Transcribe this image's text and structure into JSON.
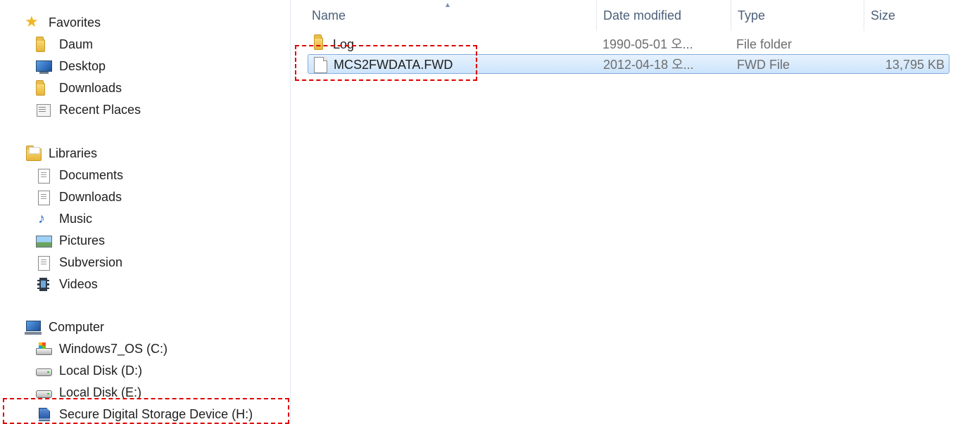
{
  "navigation": {
    "favorites": {
      "label": "Favorites",
      "items": [
        {
          "label": "Daum",
          "icon": "folder-icon"
        },
        {
          "label": "Desktop",
          "icon": "desktop-icon"
        },
        {
          "label": "Downloads",
          "icon": "downloads-folder-icon"
        },
        {
          "label": "Recent Places",
          "icon": "recent-places-icon"
        }
      ]
    },
    "libraries": {
      "label": "Libraries",
      "items": [
        {
          "label": "Documents",
          "icon": "documents-icon"
        },
        {
          "label": "Downloads",
          "icon": "downloads-library-icon"
        },
        {
          "label": "Music",
          "icon": "music-icon"
        },
        {
          "label": "Pictures",
          "icon": "pictures-icon"
        },
        {
          "label": "Subversion",
          "icon": "subversion-icon"
        },
        {
          "label": "Videos",
          "icon": "videos-icon"
        }
      ]
    },
    "computer": {
      "label": "Computer",
      "items": [
        {
          "label": "Windows7_OS (C:)",
          "icon": "os-drive-icon"
        },
        {
          "label": "Local Disk (D:)",
          "icon": "hard-drive-icon"
        },
        {
          "label": "Local Disk (E:)",
          "icon": "hard-drive-icon"
        },
        {
          "label": "Secure Digital Storage Device (H:)",
          "icon": "sd-card-icon"
        }
      ]
    }
  },
  "columns": {
    "name": "Name",
    "date_modified": "Date modified",
    "type": "Type",
    "size": "Size"
  },
  "files": [
    {
      "name": "Log",
      "date_modified": "1990-05-01 오...",
      "type": "File folder",
      "size": "",
      "icon": "folder-icon"
    },
    {
      "name": "MCS2FWDATA.FWD",
      "date_modified": "2012-04-18 오...",
      "type": "FWD File",
      "size": "13,795 KB",
      "icon": "file-icon",
      "selected": true
    }
  ],
  "colors": {
    "highlight_dash": "#e00000",
    "selection_border": "#84acdd",
    "header_text": "#4c607a"
  }
}
